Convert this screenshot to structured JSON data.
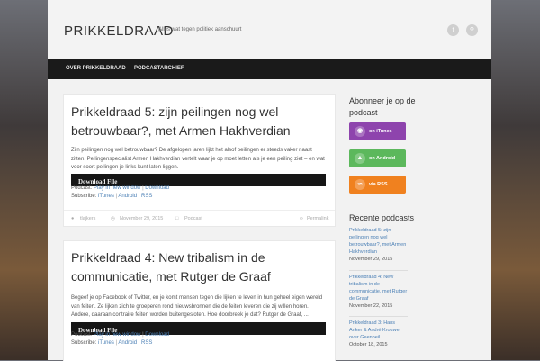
{
  "header": {
    "site_title": "PRIKKELDRAAD",
    "tagline": "Alles wat tegen politiek aanschuurt",
    "icons": [
      "twitter-icon",
      "search-icon"
    ]
  },
  "nav": {
    "items": [
      {
        "label": "OVER PRIKKELDRAAD"
      },
      {
        "label": "PODCASTARCHIEF"
      }
    ]
  },
  "posts": [
    {
      "title": "Prikkeldraad 5: zijn peilingen nog wel betrouwbaar?, met Armen Hakhverdian",
      "excerpt": "Zijn peilingen nog wel betrouwbaar? De afgelopen jaren lijkt het alsof peilingen er steeds vaker naast zitten. Peilingenspecialist Armen Hakhverdian vertelt waar je op moet letten als je een peiling ziet – en wat voor soort peilingen je links kunt laten liggen.",
      "player_label": "Download File",
      "podcast_prefix": "Podcast:",
      "play_link": "Play in new window",
      "separator": "|",
      "download_link": "Download",
      "subscribe_prefix": "Subscribe:",
      "itunes_link": "iTunes",
      "android_link": "Android",
      "rss_link": "RSS",
      "author": "tlajkers",
      "date": "November 29, 2015",
      "category": "Podcast",
      "permalink": "Permalink"
    },
    {
      "title": "Prikkeldraad 4: New tribalism in de communicatie, met Rutger de Graaf",
      "excerpt": "Begeef je op Facebook of Twitter, en je komt mensen tegen die lijken te leven in hun geheel eigen wereld van feiten. Ze lijken zich te groeperen rond nieuwsbronnen die de feiten leveren die zij willen horen. Andere, daaraan contraire feiten worden buitengesloten. Hoe doorbreek je dat? Rutger de Graaf, ...",
      "player_label": "Download File",
      "podcast_prefix": "Podcast:",
      "play_link": "Play in new window",
      "separator": "|",
      "download_link": "Download",
      "subscribe_prefix": "Subscribe:",
      "itunes_link": "iTunes",
      "android_link": "Android",
      "rss_link": "RSS"
    }
  ],
  "sidebar": {
    "subscribe_heading": "Abonneer je op de podcast",
    "buttons": [
      {
        "label": "on iTunes",
        "icon": "podcast-icon",
        "color": "#8e44ad"
      },
      {
        "label": "on Android",
        "icon": "android-icon",
        "color": "#5cb85c"
      },
      {
        "label": "via RSS",
        "icon": "rss-icon",
        "color": "#f0811f"
      }
    ],
    "recent_heading": "Recente podcasts",
    "recent": [
      {
        "title": "Prikkeldraad 5: zijn peilingen nog wel betrouwbaar?, met Armen Hakhverdian",
        "date": "November 29, 2015"
      },
      {
        "title": "Prikkeldraad 4: New tribalism in de communicatie, met Rutger de Graaf",
        "date": "November 22, 2015"
      },
      {
        "title": "Prikkeldraad 3: Hans Anker & André Krouwel over Geenpeil",
        "date": "October 18, 2015"
      }
    ]
  }
}
